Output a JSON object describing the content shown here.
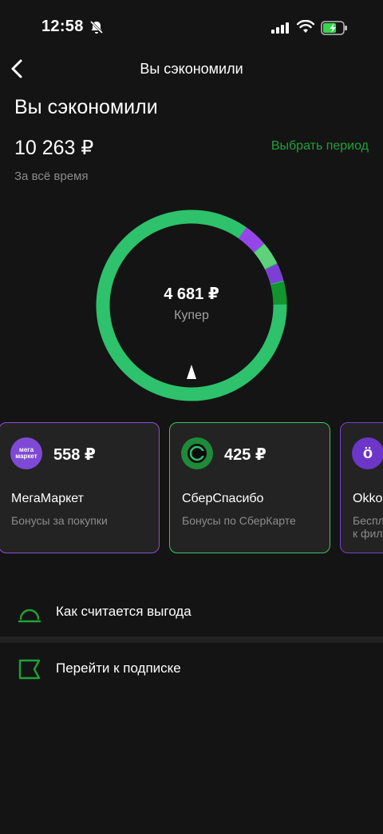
{
  "status_bar": {
    "time": "12:58"
  },
  "nav": {
    "title": "Вы сэкономили"
  },
  "summary": {
    "heading": "Вы сэкономили",
    "total": "10 263 ₽",
    "period_link": "Выбрать период",
    "period_caption": "За всё время"
  },
  "donut": {
    "center_value": "4 681 ₽",
    "center_label": "Купер"
  },
  "cards": [
    {
      "value": "558 ₽",
      "title": "МегаМаркет",
      "subtitle": "Бонусы за покупки",
      "logo_text_top": "мега",
      "logo_text_bottom": "маркет"
    },
    {
      "value": "425 ₽",
      "title": "СберСпасибо",
      "subtitle": "Бонусы по СберКарте"
    },
    {
      "value": "",
      "title": "Okko",
      "subtitle": "Беспл",
      "subtitle2": "к фил",
      "logo_text": "ö"
    }
  ],
  "links": [
    {
      "label": "Как считается выгода",
      "icon": "speedometer-icon"
    },
    {
      "label": "Перейти к подписке",
      "icon": "flag-icon"
    }
  ],
  "colors": {
    "accent_green": "#21a038",
    "ring_green": "#2dc26b",
    "purple": "#8a4ed8"
  }
}
